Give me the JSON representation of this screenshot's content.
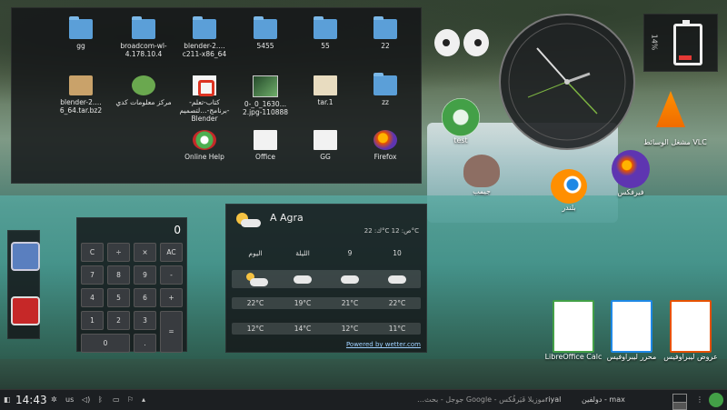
{
  "folder_view": {
    "items": [
      {
        "label": "gg",
        "kind": "folder"
      },
      {
        "label": "broadcom-wl-4.178.10.4",
        "kind": "folder"
      },
      {
        "label": "blender-2.…c211-x86_64",
        "kind": "folder"
      },
      {
        "label": "5455",
        "kind": "folder"
      },
      {
        "label": "55",
        "kind": "folder"
      },
      {
        "label": "22",
        "kind": "folder"
      },
      {
        "label": "blender-2.…6_64.tar.bz2",
        "kind": "archive"
      },
      {
        "label": "مركز معلومات كدي",
        "kind": "app"
      },
      {
        "label": "كتاب-تعلم-برنامج-…لتصميم-Blender",
        "kind": "pdf"
      },
      {
        "label": "0-_0_1630…2.jpg-110888",
        "kind": "image"
      },
      {
        "label": "tar.1",
        "kind": "doc"
      },
      {
        "label": "zz",
        "kind": "folder"
      },
      {
        "label": "Online Help",
        "kind": "help"
      },
      {
        "label": "Office",
        "kind": "doc"
      },
      {
        "label": "GG",
        "kind": "text"
      },
      {
        "label": "Firefox",
        "kind": "firefox"
      }
    ]
  },
  "battery": {
    "percent": "14%"
  },
  "desktop_icons": {
    "test": "test",
    "vlc": "مشغل الوسائط VLC",
    "gimp": "جيمب",
    "blender": "بلندر",
    "firefox": "فيرفكس",
    "calc": "LibreOffice Calc",
    "writer": "محرر ليبراوفيس",
    "impress": "عروض ليبراوفيس"
  },
  "calculator": {
    "display": "0",
    "keys": [
      "C",
      "÷",
      "×",
      "AC",
      "7",
      "8",
      "9",
      "-",
      "4",
      "5",
      "6",
      "+",
      "1",
      "2",
      "3",
      "=",
      "0",
      "."
    ]
  },
  "weather": {
    "city": "A Agra",
    "today_info": "ك: 22°C ص: 12°C",
    "days": [
      "اليوم",
      "الليلة",
      "9",
      "10"
    ],
    "highs": [
      "22°C",
      "19°C",
      "21°C",
      "22°C"
    ],
    "lows": [
      "12°C",
      "14°C",
      "12°C",
      "11°C"
    ],
    "link": "Powered by wetter.com"
  },
  "taskbar": {
    "time": "14:43",
    "layout": "us",
    "search_hint": "…جوجل - بحث Google - موزيلا فَيَرفُكس",
    "tasks": [
      "riyal",
      "دولفين - max"
    ]
  },
  "colors": {
    "accent": "#5b9fd8",
    "power": "#c62828",
    "battery_low": "#e53935"
  }
}
